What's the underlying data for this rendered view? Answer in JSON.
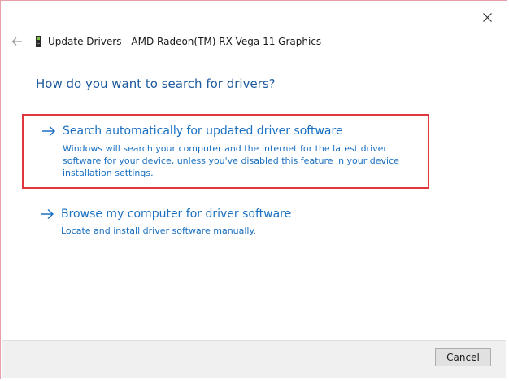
{
  "window": {
    "title": "Update Drivers - AMD Radeon(TM) RX Vega 11 Graphics",
    "icons": {
      "back": "back-arrow-icon",
      "device": "device-icon",
      "close": "close-icon"
    }
  },
  "question": "How do you want to search for drivers?",
  "options": [
    {
      "title": "Search automatically for updated driver software",
      "description": "Windows will search your computer and the Internet for the latest driver software for your device, unless you've disabled this feature in your device installation settings.",
      "icon": "arrow-right-icon"
    },
    {
      "title": "Browse my computer for driver software",
      "description": "Locate and install driver software manually.",
      "icon": "arrow-right-icon"
    }
  ],
  "footer": {
    "cancel_label": "Cancel"
  },
  "colors": {
    "link": "#1a70c2",
    "heading": "#1d5b9e",
    "highlight_border": "#e0363e"
  }
}
